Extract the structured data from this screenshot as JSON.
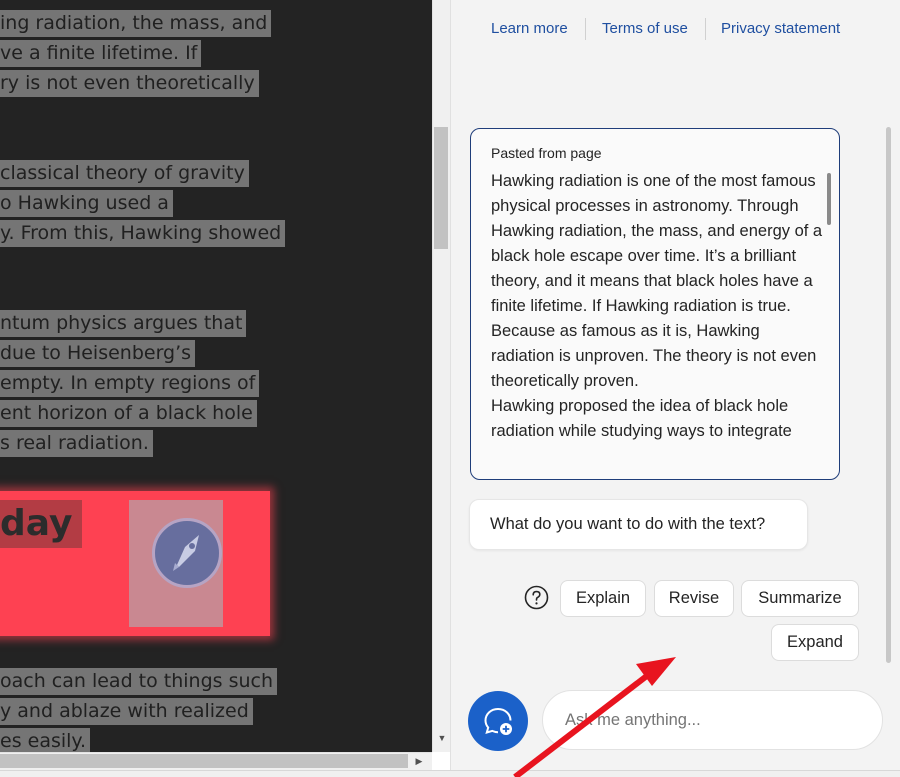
{
  "document": {
    "selected_lines": [
      "ing radiation, the mass, and",
      "ve a finite lifetime. If",
      "ry is not even theoretically",
      "classical theory of gravity",
      "o Hawking used a",
      "y. From this, Hawking showed",
      "ntum physics argues that",
      " due to Heisenberg’s",
      "empty. In empty regions of",
      "ent horizon of a black hole",
      "s real radiation.",
      "oach can lead to things such",
      "y and ablaze with realized",
      "es easily."
    ],
    "banner_text": "day",
    "banner_color": "#fe4152"
  },
  "panel": {
    "links": [
      "Learn more",
      "Terms of use",
      "Privacy statement"
    ],
    "pasted_label": "Pasted from page",
    "pasted_text": "Hawking radiation is one of the most famous physical processes in astronomy. Through Hawking radiation, the mass, and energy of a black hole escape over time. It’s a brilliant theory, and it means that black holes have a finite lifetime. If Hawking radiation is true. Because as famous as it is, Hawking radiation is unproven. The theory is not even theoretically proven.\nHawking proposed the idea of black hole radiation while studying ways to integrate",
    "question": "What do you want to do with the text?",
    "actions": [
      "Explain",
      "Revise",
      "Summarize",
      "Expand"
    ],
    "help_icon": "question-circle-icon",
    "new_chat_icon": "chat-add-icon",
    "ask_placeholder": "Ask me anything...",
    "accent_color": "#1b61c9",
    "annotation_arrow_color": "#e8141f"
  }
}
